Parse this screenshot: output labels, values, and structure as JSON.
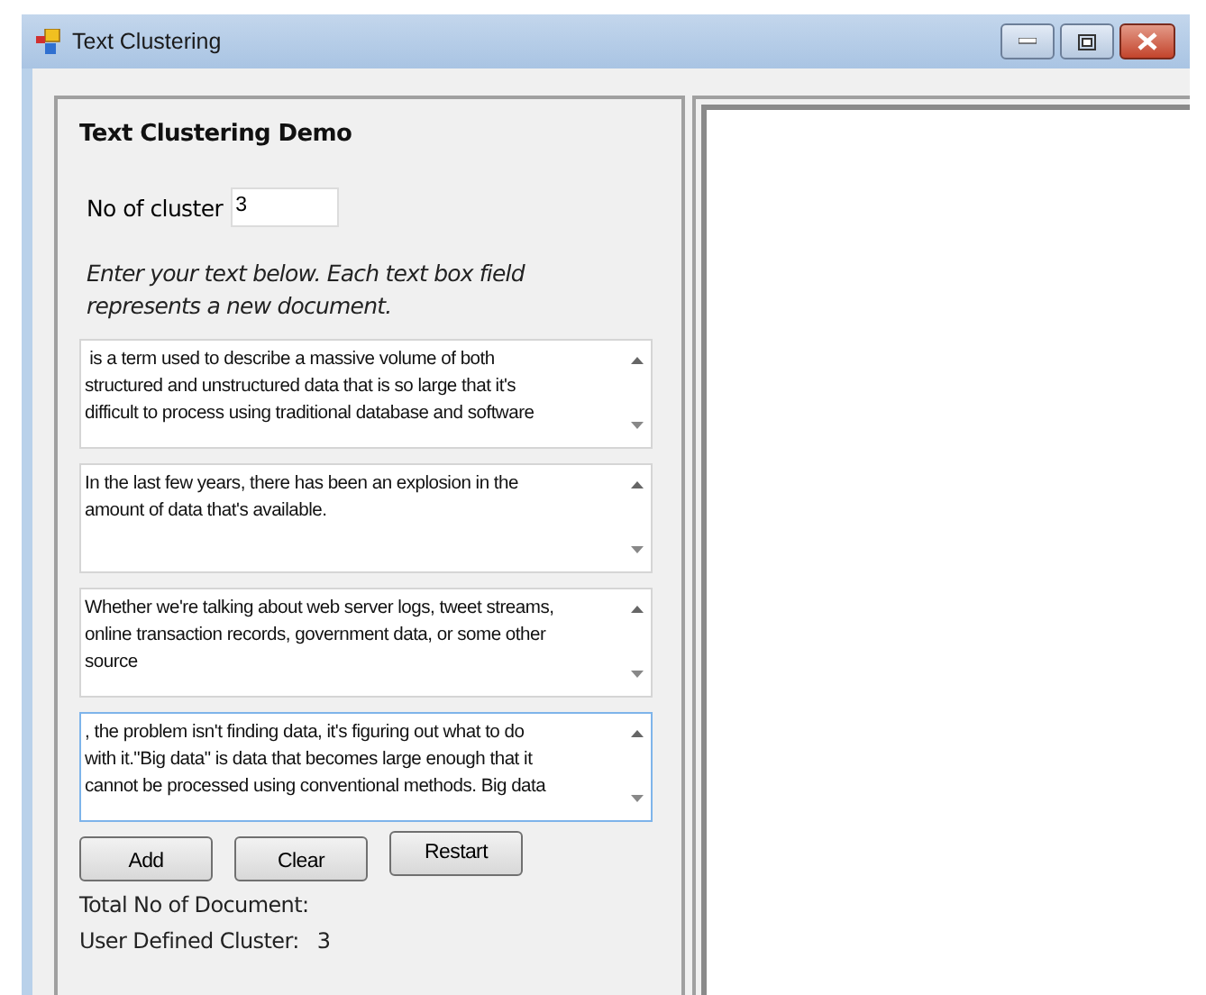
{
  "window": {
    "title": "Text Clustering"
  },
  "panel": {
    "heading": "Text Clustering Demo",
    "cluster_label": "No of cluster",
    "cluster_value": "3",
    "instruction": "Enter your text below. Each text box field represents a new document."
  },
  "documents": [
    {
      "lines": [
        " is a term used to describe a massive volume of both",
        "structured and unstructured data that is so large that it's",
        "difficult to process using traditional database and software"
      ],
      "focused": false
    },
    {
      "lines": [
        "In the last few years, there has been an explosion in the",
        "amount of data that's available."
      ],
      "focused": false
    },
    {
      "lines": [
        "Whether we're talking about web server logs, tweet streams,",
        "online transaction records, government data, or some other",
        "source"
      ],
      "focused": false
    },
    {
      "lines": [
        ", the problem isn't finding data, it's figuring out what to do",
        "with it.\"Big data\" is data that becomes large enough that it",
        "cannot be processed using conventional methods. Big data"
      ],
      "focused": true
    }
  ],
  "buttons": [
    "Add",
    "Clear",
    "Restart"
  ],
  "stats": [
    {
      "label": "Total No of Document:"
    },
    {
      "label": "User Defined Cluster:",
      "value": "3"
    }
  ]
}
